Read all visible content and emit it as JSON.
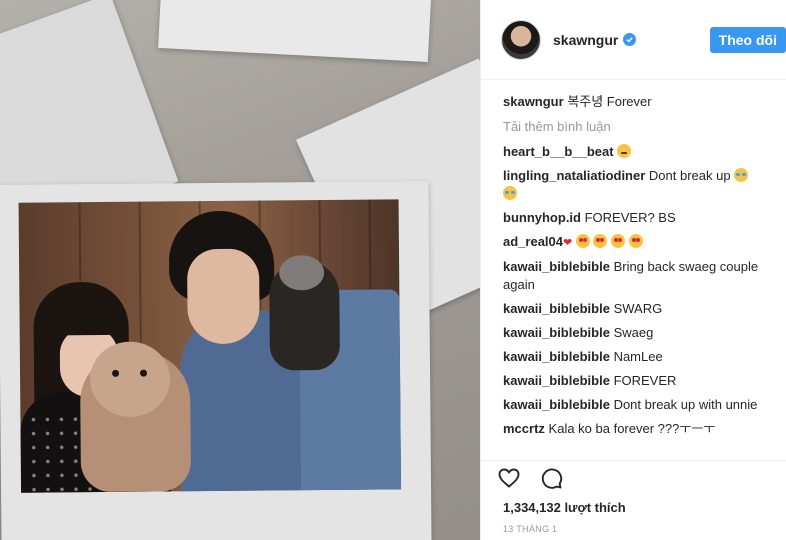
{
  "post": {
    "username": "skawngur",
    "follow_label": "Theo dõi",
    "caption_text": "복주녕 Forever",
    "load_more": "Tải thêm bình luận",
    "likes": "1,334,132 lượt thích",
    "date": "13 THÁNG 1"
  },
  "comments": [
    {
      "user": "heart_b__b__beat",
      "text": ""
    },
    {
      "user": "lingling_nataliatiodiner",
      "text": "Dont break up"
    },
    {
      "user": "bunnyhop.id",
      "text": "FOREVER? BS"
    },
    {
      "user": "ad_real04",
      "text": ""
    },
    {
      "user": "kawaii_biblebible",
      "text": "Bring back swaeg couple again"
    },
    {
      "user": "kawaii_biblebible",
      "text": "SWARG"
    },
    {
      "user": "kawaii_biblebible",
      "text": "Swaeg"
    },
    {
      "user": "kawaii_biblebible",
      "text": "NamLee"
    },
    {
      "user": "kawaii_biblebible",
      "text": "FOREVER"
    },
    {
      "user": "kawaii_biblebible",
      "text": "Dont break up with unnie"
    },
    {
      "user": "mccrtz",
      "text": "Kala ko ba forever ???ㅜㅡㅜ"
    }
  ],
  "icons": {
    "verified": "verified-badge-icon",
    "like": "heart-outline-icon",
    "comment": "comment-bubble-icon"
  },
  "colors": {
    "accent": "#3897f0",
    "text": "#262626",
    "muted": "#999999"
  }
}
